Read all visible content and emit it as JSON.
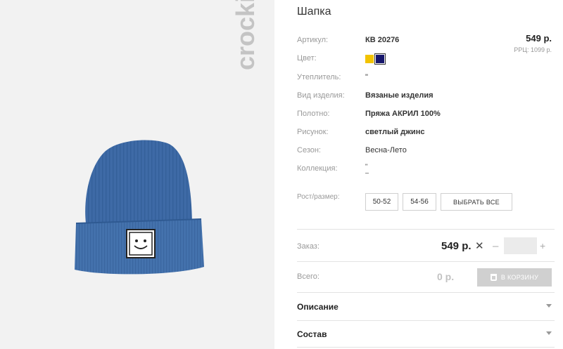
{
  "product": {
    "title": "Шапка",
    "brand": "crockid"
  },
  "attributes": [
    {
      "label": "Артикул:",
      "value": "КВ 20276"
    },
    {
      "label": "Цвет:",
      "value": ""
    },
    {
      "label": "Утеплитель:",
      "value": "\""
    },
    {
      "label": "Вид изделия:",
      "value": "Вязаные изделия"
    },
    {
      "label": "Полотно:",
      "value": "Пряжа АКРИЛ 100%"
    },
    {
      "label": "Рисунок:",
      "value": "светлый джинс"
    },
    {
      "label": "Сезон:",
      "value": "Весна-Лето"
    },
    {
      "label": "Коллекция:",
      "value": "\""
    }
  ],
  "collection_extra": "–",
  "colors": [
    "#f2c300",
    "#16166b"
  ],
  "price": {
    "main": "549 р.",
    "rrc": "РРЦ: 1099 р."
  },
  "sizes": {
    "label": "Рост/размер:",
    "options": [
      "50-52",
      "54-56"
    ],
    "select_all": "ВЫБРАТЬ ВСЕ"
  },
  "order": {
    "label": "Заказ:",
    "price": "549 р.",
    "times": "✕",
    "minus": "–",
    "qty_value": "",
    "plus": "+"
  },
  "total": {
    "label": "Всего:",
    "value": "0 р.",
    "cart_label": "В КОРЗИНУ"
  },
  "accordion": [
    {
      "label": "Описание"
    },
    {
      "label": "Состав"
    }
  ]
}
